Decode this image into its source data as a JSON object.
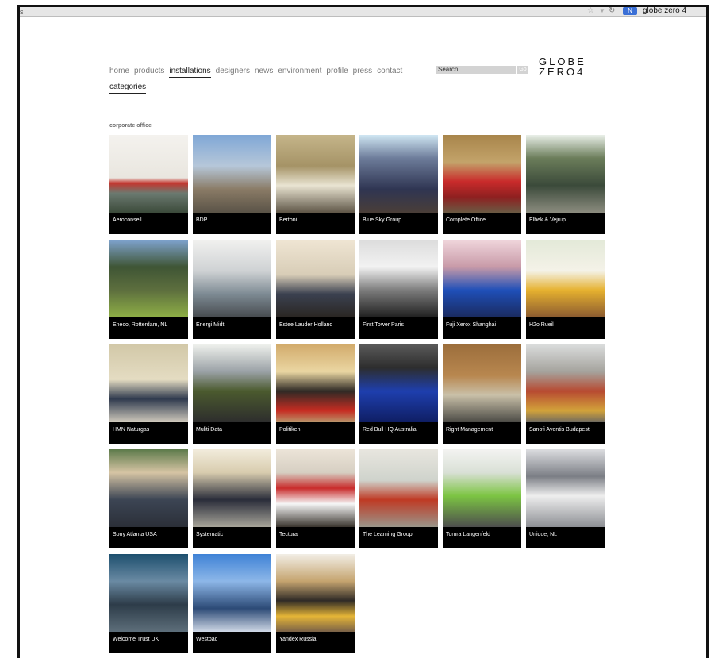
{
  "browser": {
    "stray_char": "s",
    "search_engine_label": "N",
    "search_query": "globe zero 4"
  },
  "nav": {
    "items": [
      "home",
      "products",
      "installations",
      "designers",
      "news",
      "environment",
      "profile",
      "press",
      "contact"
    ],
    "active": "installations"
  },
  "categories_label": "categories",
  "search": {
    "placeholder": "Search",
    "go_label": "Go"
  },
  "logo": {
    "line1": "GLOBE",
    "line2": "ZERO4"
  },
  "section_label": "corporate office",
  "tiles": [
    {
      "caption": "Aeroconseil"
    },
    {
      "caption": "BDP"
    },
    {
      "caption": "Bertoni"
    },
    {
      "caption": "Blue Sky Group"
    },
    {
      "caption": "Complete Office"
    },
    {
      "caption": "Elbek & Vejrup"
    },
    {
      "caption": "Eneco, Rotterdam, NL"
    },
    {
      "caption": "Energi Midt"
    },
    {
      "caption": "Estee Lauder Holland"
    },
    {
      "caption": "First Tower Paris"
    },
    {
      "caption": "Fuji Xerox Shanghai"
    },
    {
      "caption": "H2o Rueil"
    },
    {
      "caption": "HMN Naturgas"
    },
    {
      "caption": "Muliti Data"
    },
    {
      "caption": "Politiken"
    },
    {
      "caption": "Red Bull HQ Australia"
    },
    {
      "caption": "Right Management"
    },
    {
      "caption": "Sanofi Aventis Budapest"
    },
    {
      "caption": "Sony Atlanta USA"
    },
    {
      "caption": "Systematic"
    },
    {
      "caption": "Tectura"
    },
    {
      "caption": "The Learning Group"
    },
    {
      "caption": "Tomra Langenfeld"
    },
    {
      "caption": "Unique, NL"
    },
    {
      "caption": "Welcome Trust UK"
    },
    {
      "caption": "Westpac"
    },
    {
      "caption": "Yandex Russia"
    }
  ]
}
